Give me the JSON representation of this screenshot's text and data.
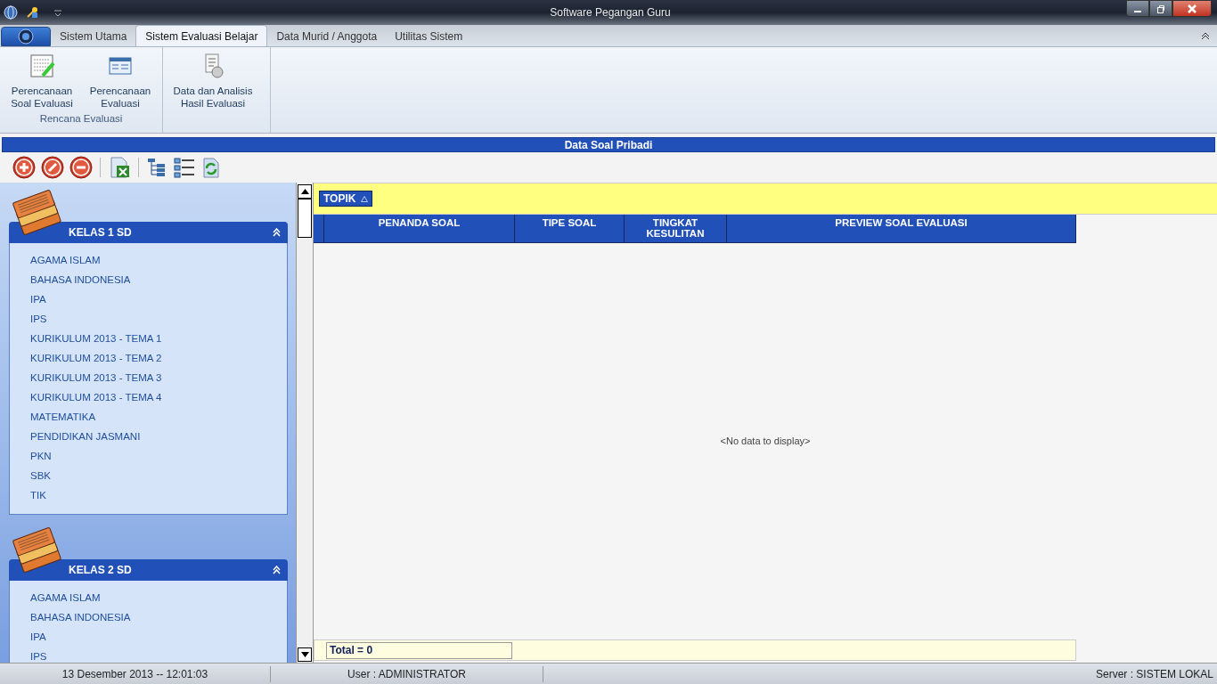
{
  "window": {
    "title": "Software Pegangan Guru"
  },
  "tabs": [
    {
      "label": "Sistem Utama",
      "selected": false
    },
    {
      "label": "Sistem Evaluasi Belajar",
      "selected": true
    },
    {
      "label": "Data Murid / Anggota",
      "selected": false
    },
    {
      "label": "Utilitas Sistem",
      "selected": false
    }
  ],
  "ribbon": {
    "groups": [
      {
        "label": "Rencana Evaluasi",
        "buttons": [
          {
            "label": "Perencanaan Soal Evaluasi",
            "kind": "grid"
          },
          {
            "label": "Perencanaan Evaluasi",
            "kind": "form"
          }
        ]
      },
      {
        "buttons": [
          {
            "label": "Data dan Analisis Hasil Evaluasi",
            "kind": "report"
          }
        ]
      }
    ]
  },
  "panel": {
    "title": "Data Soal Pribadi"
  },
  "sidebar": {
    "groups": [
      {
        "title": "KELAS 1 SD",
        "expanded": true,
        "items": [
          "AGAMA ISLAM",
          "BAHASA INDONESIA",
          "IPA",
          "IPS",
          "KURIKULUM 2013 - TEMA 1",
          "KURIKULUM 2013 - TEMA 2",
          "KURIKULUM 2013 - TEMA 3",
          "KURIKULUM 2013 - TEMA 4",
          "MATEMATIKA",
          "PENDIDIKAN JASMANI",
          "PKN",
          "SBK",
          "TIK"
        ]
      },
      {
        "title": "KELAS 2 SD",
        "expanded": true,
        "items": [
          "AGAMA ISLAM",
          "BAHASA INDONESIA",
          "IPA",
          "IPS"
        ]
      }
    ]
  },
  "grid": {
    "group_by": "TOPIK",
    "columns": [
      "PENANDA SOAL",
      "TIPE SOAL",
      "TINGKAT KESULITAN",
      "PREVIEW SOAL EVALUASI"
    ],
    "empty_text": "<No data to display>",
    "footer": "Total = 0"
  },
  "status_bar": {
    "date": "13 Desember 2013 -- 12:01:03",
    "user": "User : ADMINISTRATOR",
    "server": "Server : SISTEM LOKAL"
  }
}
